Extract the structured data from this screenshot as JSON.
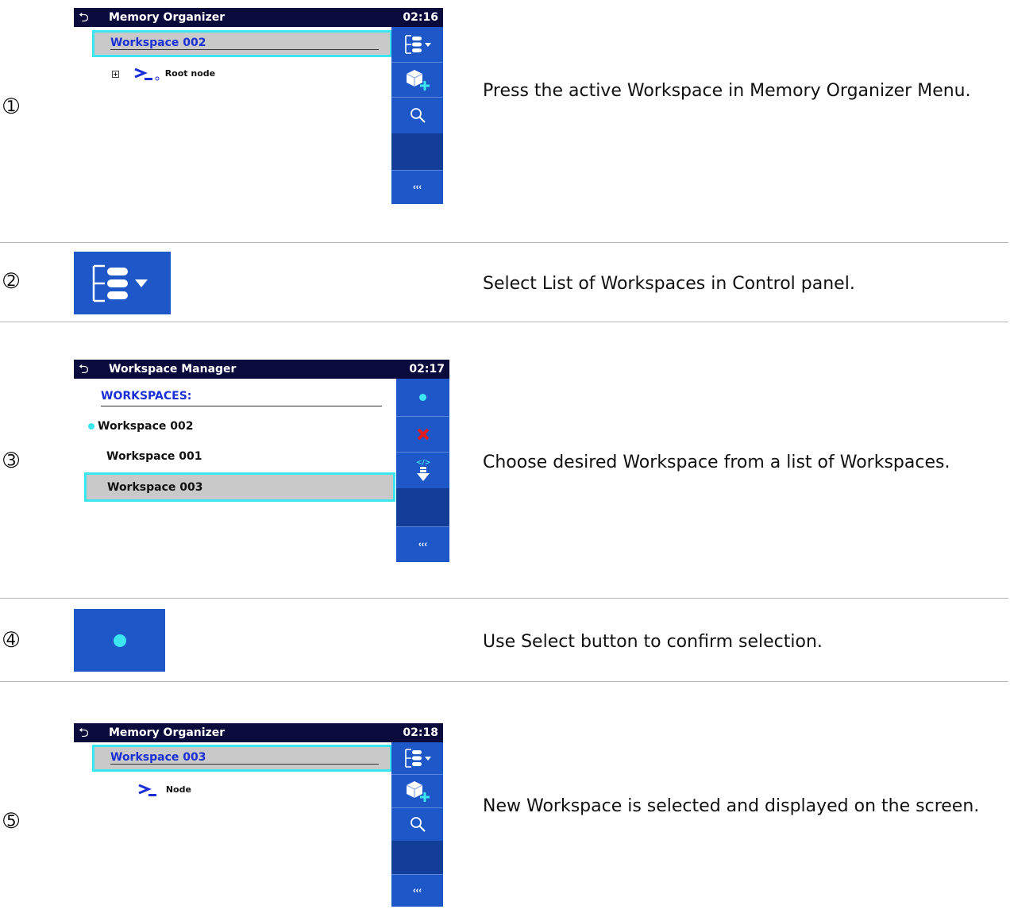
{
  "steps": [
    {
      "number": "➀",
      "description": "Press the active Workspace in Memory Organizer Menu.",
      "screen": {
        "title": "Memory Organizer",
        "time": "02:16",
        "active_workspace": "Workspace 002",
        "tree_item": "Root node",
        "panel_more": "‹‹‹"
      }
    },
    {
      "number": "➁",
      "description": "Select List of Workspaces in Control panel.",
      "icon": "workspace-list-icon"
    },
    {
      "number": "➂",
      "description": "Choose desired Workspace from a list of Workspaces.",
      "screen": {
        "title": "Workspace Manager",
        "time": "02:17",
        "header": "WORKSPACES:",
        "workspaces": [
          "Workspace 002",
          "Workspace 001",
          "Workspace 003"
        ],
        "panel_more": "‹‹‹"
      }
    },
    {
      "number": "➃",
      "description": "Use Select button to confirm selection.",
      "icon": "select-dot-icon"
    },
    {
      "number": "➄",
      "description": "New Workspace is selected and displayed on the screen.",
      "screen": {
        "title": "Memory Organizer",
        "time": "02:18",
        "active_workspace": "Workspace 003",
        "tree_item": "Node",
        "panel_more": "‹‹‹"
      }
    }
  ],
  "colors": {
    "title_bar": "#0a0a3c",
    "panel_blue": "#1e57c8",
    "highlight_cyan": "#3ce6f0",
    "selected_grey": "#c9c9c9",
    "link_blue": "#1a2fd6",
    "delete_red": "#e21b1b"
  }
}
